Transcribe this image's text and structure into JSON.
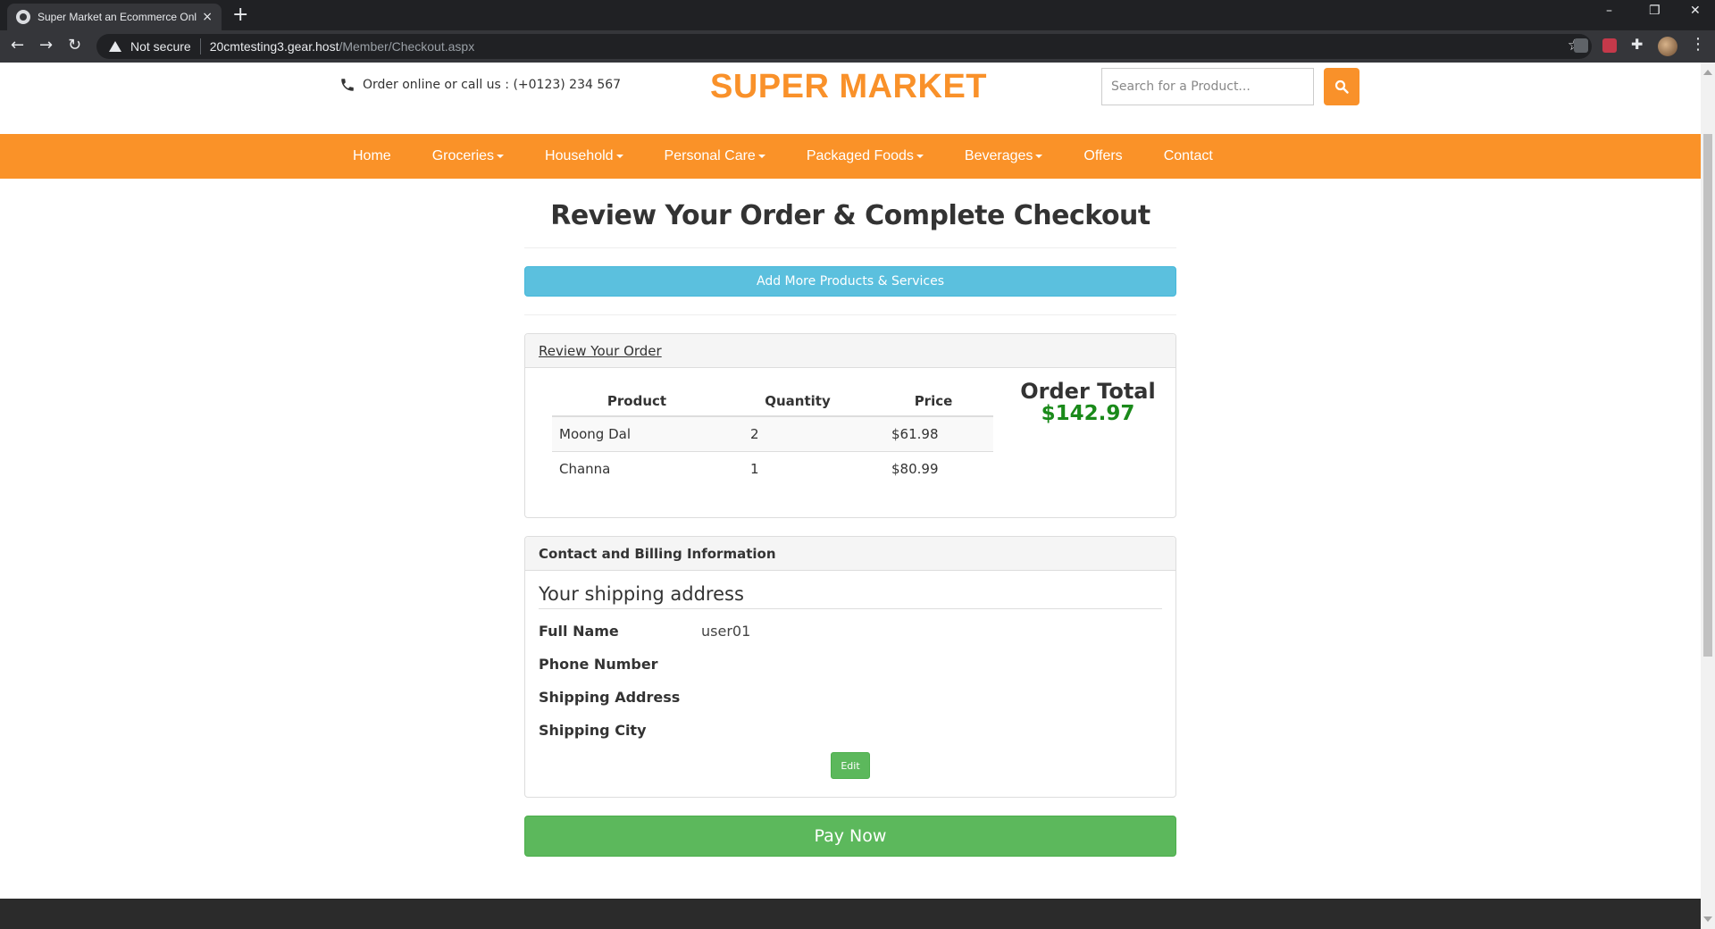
{
  "browser": {
    "tab_title": "Super Market an Ecommerce Onl",
    "tab_close": "×",
    "new_tab": "+",
    "security_label": "Not secure",
    "url_host": "20cmtesting3.gear.host",
    "url_path": "/Member/Checkout.aspx",
    "minimize": "–",
    "restore": "❐",
    "close": "✕",
    "back": "←",
    "forward": "→",
    "reload": "↻",
    "star": "☆",
    "menu": "⋮"
  },
  "header": {
    "call_text": "Order online or call us : (+0123) 234 567",
    "logo": "SUPER MARKET",
    "search_placeholder": "Search for a Product..."
  },
  "nav": {
    "items": [
      {
        "label": "Home",
        "dropdown": false
      },
      {
        "label": "Groceries",
        "dropdown": true
      },
      {
        "label": "Household",
        "dropdown": true
      },
      {
        "label": "Personal Care",
        "dropdown": true
      },
      {
        "label": "Packaged Foods",
        "dropdown": true
      },
      {
        "label": "Beverages",
        "dropdown": true
      },
      {
        "label": "Offers",
        "dropdown": false
      },
      {
        "label": "Contact",
        "dropdown": false
      }
    ]
  },
  "checkout": {
    "title": "Review Your Order & Complete Checkout",
    "add_more_label": "Add More Products & Services",
    "review_heading": "Review Your Order",
    "columns": [
      "Product",
      "Quantity",
      "Price"
    ],
    "rows": [
      {
        "product": "Moong Dal",
        "quantity": "2",
        "price": "$61.98"
      },
      {
        "product": "Channa",
        "quantity": "1",
        "price": "$80.99"
      }
    ],
    "total_label": "Order Total",
    "total_value": "$142.97",
    "billing_heading": "Contact and Billing Information",
    "shipping_heading": "Your shipping address",
    "fields": [
      {
        "label": "Full Name",
        "value": "user01"
      },
      {
        "label": "Phone Number",
        "value": ""
      },
      {
        "label": "Shipping Address",
        "value": ""
      },
      {
        "label": "Shipping City",
        "value": ""
      }
    ],
    "edit_label": "Edit",
    "pay_label": "Pay Now"
  },
  "colors": {
    "brand_orange": "#f9912a",
    "info_blue": "#5bc0de",
    "success_green": "#5cb85c",
    "total_green": "#1a8a1a"
  }
}
